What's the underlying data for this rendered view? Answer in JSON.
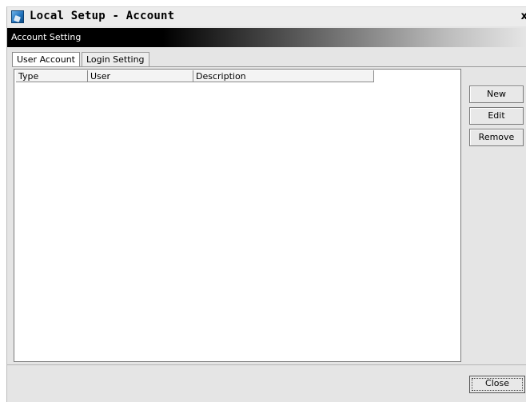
{
  "window": {
    "title": "Local Setup - Account",
    "close_glyph": "x"
  },
  "header": {
    "section": "Account Setting"
  },
  "tabs": [
    {
      "label": "User Account",
      "active": true
    },
    {
      "label": "Login Setting",
      "active": false
    }
  ],
  "table": {
    "columns": [
      "Type",
      "User",
      "Description"
    ],
    "rows": []
  },
  "actions": {
    "new": "New",
    "edit": "Edit",
    "remove": "Remove"
  },
  "footer": {
    "close": "Close"
  },
  "icons": {
    "app": "app-setup-icon"
  }
}
